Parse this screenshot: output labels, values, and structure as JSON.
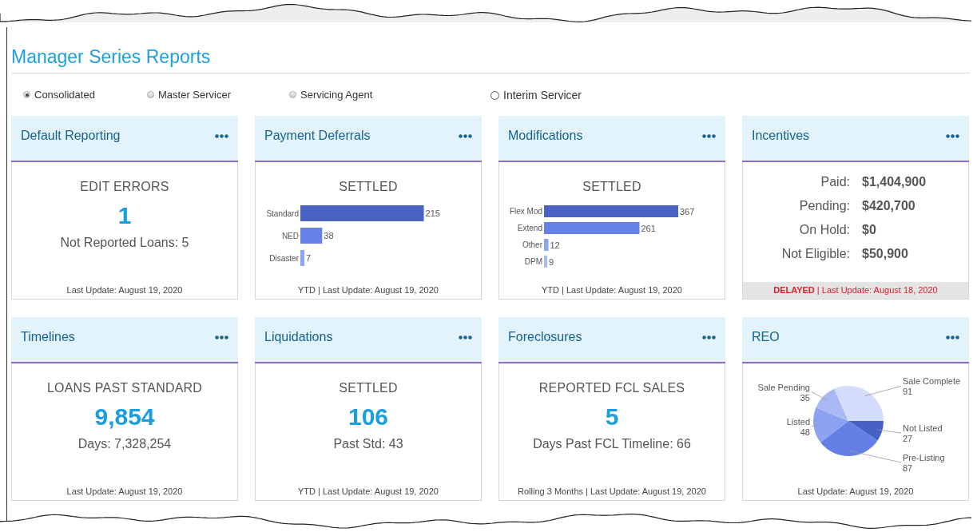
{
  "title": "Manager Series Reports",
  "report_types": [
    {
      "label": "Consolidated",
      "selected": true,
      "kind": "shaded"
    },
    {
      "label": "Master Servicer",
      "selected": false,
      "kind": "shaded"
    },
    {
      "label": "Servicing Agent",
      "selected": false,
      "kind": "shaded"
    },
    {
      "label": "Interim Servicer",
      "selected": false,
      "kind": "plain"
    }
  ],
  "cards": [
    {
      "kind": "metric",
      "title": "Default Reporting",
      "subtitle": "EDIT ERRORS",
      "value": "1",
      "detail": "Not Reported Loans: 5",
      "footer": {
        "text": "Last Update: August 19, 2020",
        "delayed": false
      }
    },
    {
      "kind": "bars",
      "title": "Payment Deferrals",
      "subtitle": "SETTLED",
      "chart_data": {
        "type": "bar",
        "orientation": "horizontal",
        "categories": [
          "Standard",
          "NED",
          "Disaster"
        ],
        "values": [
          215,
          38,
          7
        ],
        "data_labels": true
      },
      "footer": {
        "text": "YTD | Last Update: August 19, 2020",
        "delayed": false
      }
    },
    {
      "kind": "bars",
      "title": "Modifications",
      "subtitle": "SETTLED",
      "chart_data": {
        "type": "bar",
        "orientation": "horizontal",
        "categories": [
          "Flex Mod",
          "Extend",
          "Other",
          "DPM"
        ],
        "values": [
          367,
          261,
          12,
          9
        ],
        "data_labels": true
      },
      "footer": {
        "text": "YTD | Last Update: August 19, 2020",
        "delayed": false
      }
    },
    {
      "kind": "amounts",
      "title": "Incentives",
      "rows": [
        {
          "label": "Paid:",
          "value": "$1,404,900"
        },
        {
          "label": "Pending:",
          "value": "$420,700"
        },
        {
          "label": "On Hold:",
          "value": "$0"
        },
        {
          "label": "Not Eligible:",
          "value": "$50,900"
        }
      ],
      "footer": {
        "text": "**DELAYED** | Last Update: August 18, 2020",
        "delayed": true
      }
    },
    {
      "kind": "metric",
      "title": "Timelines",
      "subtitle": "LOANS PAST STANDARD",
      "value": "9,854",
      "detail": "Days: 7,328,254",
      "footer": {
        "text": "Last Update: August 19, 2020",
        "delayed": false
      }
    },
    {
      "kind": "metric",
      "title": "Liquidations",
      "subtitle": "SETTLED",
      "value": "106",
      "detail": "Past Std: 43",
      "footer": {
        "text": "YTD | Last Update: August 19, 2020",
        "delayed": false
      }
    },
    {
      "kind": "metric",
      "title": "Foreclosures",
      "subtitle": "REPORTED FCL SALES",
      "value": "5",
      "detail": "Days Past FCL Timeline: 66",
      "footer": {
        "text": "Rolling 3 Months | Last Update: August 19, 2020",
        "delayed": false
      }
    },
    {
      "kind": "pie",
      "title": "REO",
      "chart_data": {
        "type": "pie",
        "categories": [
          "Not Listed",
          "Pre-Listing",
          "Listed",
          "Sale Pending",
          "Sale Complete"
        ],
        "values": [
          27,
          87,
          48,
          35,
          91
        ],
        "data_labels": true
      },
      "footer": {
        "text": "Last Update: August 19, 2020",
        "delayed": false
      }
    }
  ]
}
